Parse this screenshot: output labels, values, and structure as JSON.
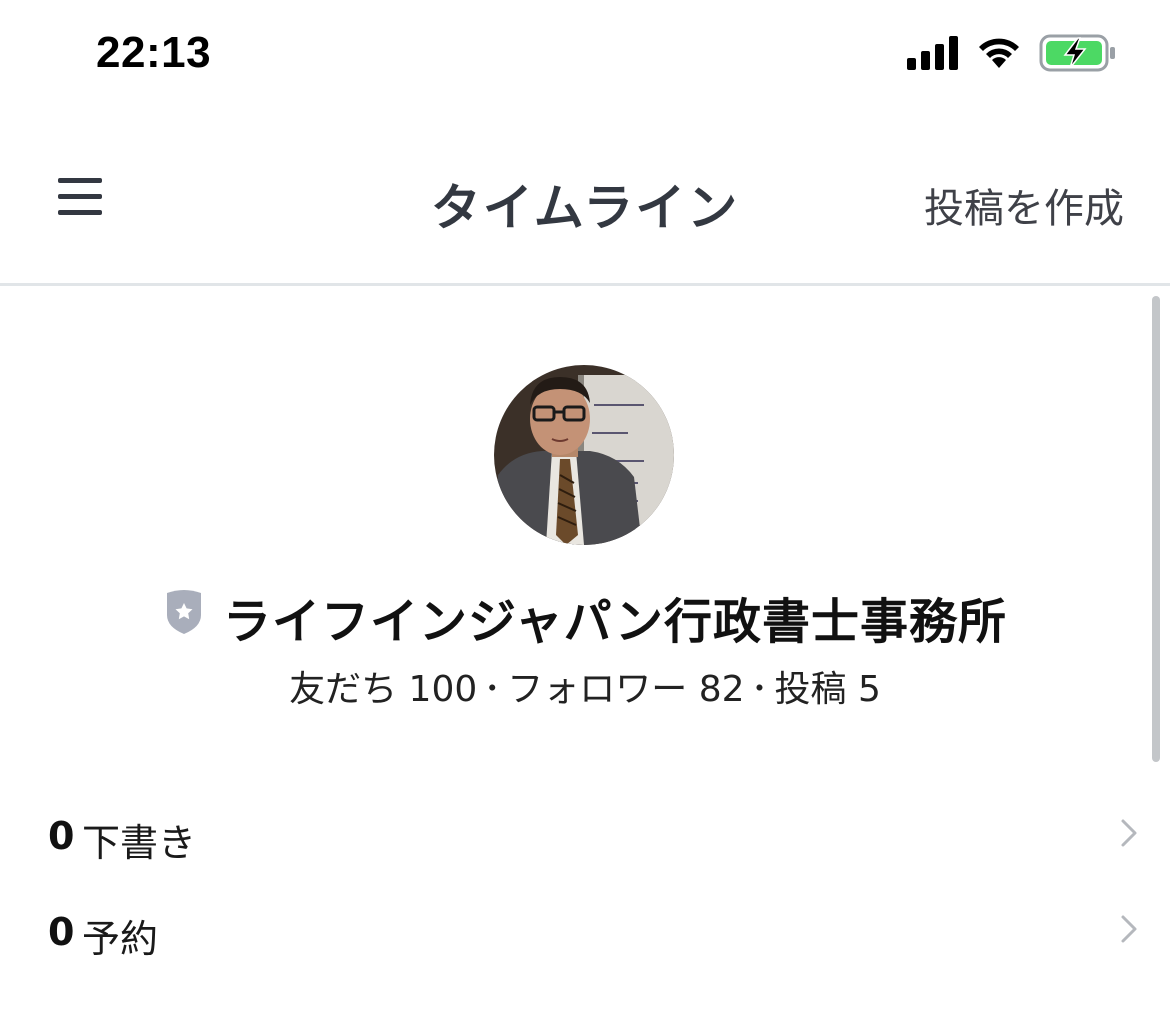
{
  "status_bar": {
    "time": "22:13",
    "icons": [
      "cellular-signal-icon",
      "wifi-icon",
      "battery-charging-icon"
    ]
  },
  "nav": {
    "menu_icon": "hamburger-menu-icon",
    "title": "タイムライン",
    "action_label": "投稿を作成"
  },
  "profile": {
    "name": "ライフインジャパン行政書士事務所",
    "badge_icon": "shield-star-icon",
    "stats": {
      "friends_label": "友だち",
      "friends_count": "100",
      "followers_label": "フォロワー",
      "followers_count": "82",
      "posts_label": "投稿",
      "posts_count": "5",
      "separator": "･"
    }
  },
  "rows": [
    {
      "count": "0",
      "label": "下書き"
    },
    {
      "count": "0",
      "label": "予約"
    }
  ],
  "colors": {
    "text_primary": "#111111",
    "nav_text": "#333841",
    "divider": "#e1e5e8",
    "badge": "#a9aebb",
    "chevron": "#b5b8bd",
    "battery_fill": "#4cd964"
  }
}
